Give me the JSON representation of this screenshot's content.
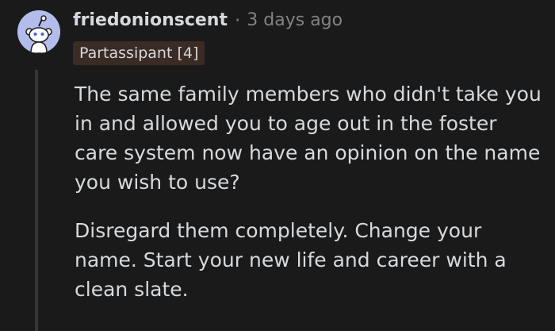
{
  "comment": {
    "author": "friedonionscent",
    "separator": "·",
    "timestamp": "3 days ago",
    "flair": "Partassipant [4]",
    "avatar_icon": "reddit-snoo-avatar-icon",
    "paragraphs": [
      "The same family members who didn't take you in and allowed you to age out in the foster care system now have an opinion on the name you wish to use?",
      "Disregard them completely. Change your name. Start your new life and career with a clean slate."
    ]
  },
  "colors": {
    "background": "#1a1a1b",
    "text": "#d7dadc",
    "meta": "#818384",
    "flair_bg": "#3a2b25",
    "avatar_bg": "#b4bceb",
    "thread_line": "#343536"
  }
}
